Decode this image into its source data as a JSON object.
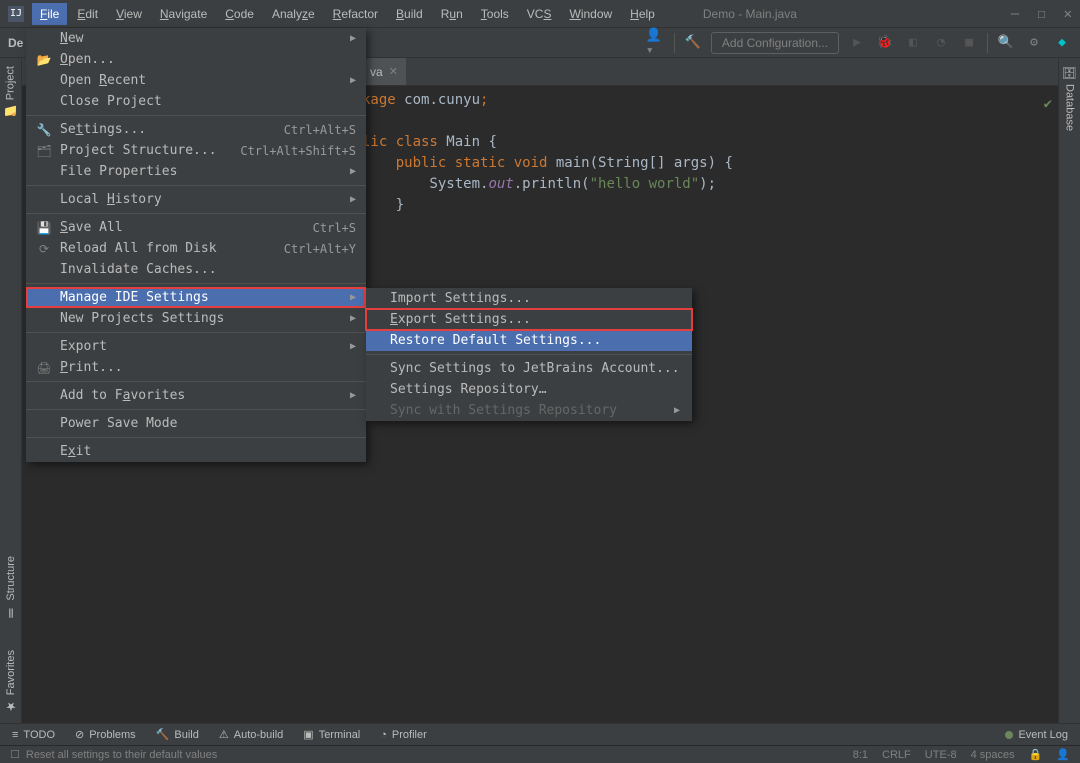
{
  "window": {
    "title": "Demo - Main.java"
  },
  "menubar": [
    "File",
    "Edit",
    "View",
    "Navigate",
    "Code",
    "Analyze",
    "Refactor",
    "Build",
    "Run",
    "Tools",
    "VCS",
    "Window",
    "Help"
  ],
  "toolbar": {
    "project": "De",
    "config": "Add Configuration..."
  },
  "file_menu": {
    "new": "New",
    "open": "Open...",
    "open_recent": "Open Recent",
    "close_project": "Close Project",
    "settings": "Settings...",
    "settings_sc": "Ctrl+Alt+S",
    "project_structure": "Project Structure...",
    "project_structure_sc": "Ctrl+Alt+Shift+S",
    "file_properties": "File Properties",
    "local_history": "Local History",
    "save_all": "Save All",
    "save_all_sc": "Ctrl+S",
    "reload": "Reload All from Disk",
    "reload_sc": "Ctrl+Alt+Y",
    "invalidate": "Invalidate Caches...",
    "manage_ide": "Manage IDE Settings",
    "new_projects_settings": "New Projects Settings",
    "export": "Export",
    "print": "Print...",
    "add_favorites": "Add to Favorites",
    "power_save": "Power Save Mode",
    "exit": "Exit"
  },
  "submenu": {
    "import": "Import Settings...",
    "export": "Export Settings...",
    "restore": "Restore Default Settings...",
    "sync_jb": "Sync Settings to JetBrains Account...",
    "repo": "Settings Repository…",
    "sync_repo": "Sync with Settings Repository"
  },
  "tabs": {
    "file": "va"
  },
  "code": {
    "l1a": "kage ",
    "l1b": "com.cunyu",
    "l1c": ";",
    "l3a": "lic class ",
    "l3b": "Main ",
    "l3c": "{",
    "l4a": "    public static void ",
    "l4b": "main",
    "l4c": "(String[] args) {",
    "l5a": "        System.",
    "l5b": "out",
    "l5c": ".println(",
    "l5d": "\"hello world\"",
    "l5e": ");",
    "l6": "    }"
  },
  "sidebar": {
    "project": "Project",
    "structure": "Structure",
    "favorites": "Favorites",
    "database": "Database"
  },
  "bottom": {
    "todo": "TODO",
    "problems": "Problems",
    "build": "Build",
    "auto_build": "Auto-build",
    "terminal": "Terminal",
    "profiler": "Profiler",
    "event_log": "Event Log"
  },
  "status": {
    "hint": "Reset all settings to their default values",
    "pos": "8:1",
    "sep": "CRLF",
    "enc": "UTE-8",
    "indent": "4 spaces"
  }
}
